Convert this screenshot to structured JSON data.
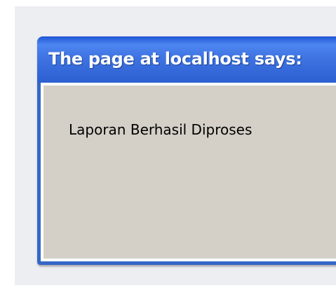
{
  "dialog": {
    "title": "The page at localhost says:",
    "message": "Laporan Berhasil Diproses"
  },
  "colors": {
    "titlebar": "#3f74e2",
    "client": "#d4d0c8",
    "backdrop": "#eceef2"
  }
}
